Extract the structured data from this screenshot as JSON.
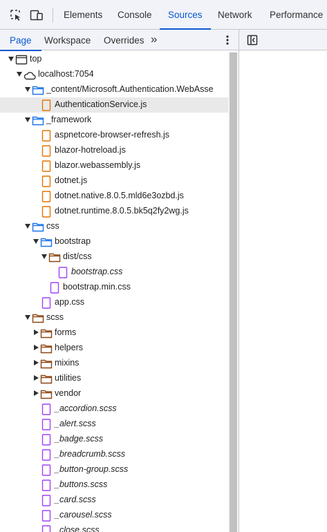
{
  "toolbar": {
    "tabs": [
      {
        "label": "Elements"
      },
      {
        "label": "Console"
      },
      {
        "label": "Sources"
      },
      {
        "label": "Network"
      },
      {
        "label": "Performance"
      }
    ],
    "active_tab": "Sources"
  },
  "navigator": {
    "tabs": [
      {
        "label": "Page"
      },
      {
        "label": "Workspace"
      },
      {
        "label": "Overrides"
      }
    ],
    "more_glyph": "»"
  },
  "tree": [
    {
      "label": "top",
      "depth": 0,
      "kind": "frame",
      "state": "open"
    },
    {
      "label": "localhost:7054",
      "depth": 1,
      "kind": "domain",
      "state": "open"
    },
    {
      "label": "_content/Microsoft.Authentication.WebAsse",
      "depth": 2,
      "kind": "folder-blue",
      "state": "open"
    },
    {
      "label": "AuthenticationService.js",
      "depth": 3,
      "kind": "file-js",
      "selected": true
    },
    {
      "label": "_framework",
      "depth": 2,
      "kind": "folder-blue",
      "state": "open"
    },
    {
      "label": "aspnetcore-browser-refresh.js",
      "depth": 3,
      "kind": "file-js"
    },
    {
      "label": "blazor-hotreload.js",
      "depth": 3,
      "kind": "file-js"
    },
    {
      "label": "blazor.webassembly.js",
      "depth": 3,
      "kind": "file-js"
    },
    {
      "label": "dotnet.js",
      "depth": 3,
      "kind": "file-js"
    },
    {
      "label": "dotnet.native.8.0.5.mld6e3ozbd.js",
      "depth": 3,
      "kind": "file-js"
    },
    {
      "label": "dotnet.runtime.8.0.5.bk5q2fy2wg.js",
      "depth": 3,
      "kind": "file-js"
    },
    {
      "label": "css",
      "depth": 2,
      "kind": "folder-blue",
      "state": "open"
    },
    {
      "label": "bootstrap",
      "depth": 3,
      "kind": "folder-blue",
      "state": "open"
    },
    {
      "label": "dist/css",
      "depth": 4,
      "kind": "folder-brown",
      "state": "open"
    },
    {
      "label": "bootstrap.css",
      "depth": 5,
      "kind": "file-css",
      "italic": true
    },
    {
      "label": "bootstrap.min.css",
      "depth": 4,
      "kind": "file-css"
    },
    {
      "label": "app.css",
      "depth": 3,
      "kind": "file-css"
    },
    {
      "label": "scss",
      "depth": 2,
      "kind": "folder-brown",
      "state": "open"
    },
    {
      "label": "forms",
      "depth": 3,
      "kind": "folder-brown",
      "state": "closed"
    },
    {
      "label": "helpers",
      "depth": 3,
      "kind": "folder-brown",
      "state": "closed"
    },
    {
      "label": "mixins",
      "depth": 3,
      "kind": "folder-brown",
      "state": "closed"
    },
    {
      "label": "utilities",
      "depth": 3,
      "kind": "folder-brown",
      "state": "closed"
    },
    {
      "label": "vendor",
      "depth": 3,
      "kind": "folder-brown",
      "state": "closed"
    },
    {
      "label": "_accordion.scss",
      "depth": 3,
      "kind": "file-css",
      "italic": true
    },
    {
      "label": "_alert.scss",
      "depth": 3,
      "kind": "file-css",
      "italic": true
    },
    {
      "label": "_badge.scss",
      "depth": 3,
      "kind": "file-css",
      "italic": true
    },
    {
      "label": "_breadcrumb.scss",
      "depth": 3,
      "kind": "file-css",
      "italic": true
    },
    {
      "label": "_button-group.scss",
      "depth": 3,
      "kind": "file-css",
      "italic": true
    },
    {
      "label": "_buttons.scss",
      "depth": 3,
      "kind": "file-css",
      "italic": true
    },
    {
      "label": "_card.scss",
      "depth": 3,
      "kind": "file-css",
      "italic": true
    },
    {
      "label": "_carousel.scss",
      "depth": 3,
      "kind": "file-css",
      "italic": true
    },
    {
      "label": "_close.scss",
      "depth": 3,
      "kind": "file-css",
      "italic": true
    }
  ],
  "colors": {
    "accent": "#0b57d0",
    "folder_blue": "#1a73e8",
    "folder_brown": "#8b4513",
    "file_js": "#e37400",
    "file_css": "#a142f4"
  }
}
